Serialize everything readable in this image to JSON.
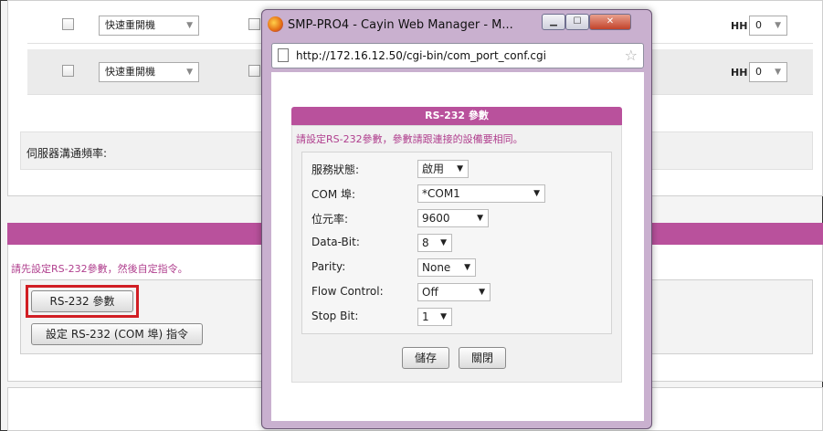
{
  "background": {
    "rows": [
      {
        "select_value": "快速重開機",
        "hh_label": "HH",
        "hh_value": "0"
      },
      {
        "select_value": "快速重開機",
        "hh_label": "HH",
        "hh_value": "0"
      }
    ],
    "server_freq_label": "伺服器溝通頻率:",
    "note": "請先設定RS-232參數，然後自定指令。",
    "rs232_params_button": "RS-232 參數",
    "rs232_command_button": "設定 RS-232 (COM 埠) 指令"
  },
  "popup": {
    "window_title": "SMP-PRO4 - Cayin Web Manager - M...",
    "url": "http://172.16.12.50/cgi-bin/com_port_conf.cgi",
    "dialog_title": "RS-232 參數",
    "instruction": "請設定RS-232參數，參數請跟連接的設備要相同。",
    "fields": [
      {
        "label": "服務狀態:",
        "value": "啟用"
      },
      {
        "label": "COM 埠:",
        "value": "*COM1"
      },
      {
        "label": "位元率:",
        "value": "9600"
      },
      {
        "label": "Data-Bit:",
        "value": "8"
      },
      {
        "label": "Parity:",
        "value": "None"
      },
      {
        "label": "Flow Control:",
        "value": "Off"
      },
      {
        "label": "Stop Bit:",
        "value": "1"
      }
    ],
    "save_button": "儲存",
    "close_button": "關閉"
  },
  "colors": {
    "accent": "#b9519c",
    "highlight": "#d11e24"
  }
}
